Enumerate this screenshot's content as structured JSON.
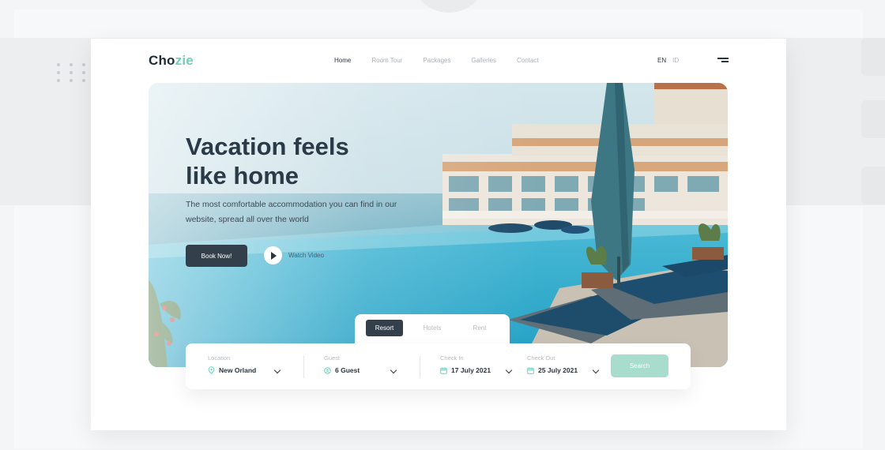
{
  "brand": {
    "logo_prefix": "Cho",
    "logo_suffix": "zie"
  },
  "nav": {
    "items": [
      {
        "label": "Home",
        "active": true
      },
      {
        "label": "Room Tour",
        "active": false
      },
      {
        "label": "Packages",
        "active": false
      },
      {
        "label": "Galleries",
        "active": false
      },
      {
        "label": "Contact",
        "active": false
      }
    ]
  },
  "language": {
    "current": "EN",
    "other": "ID"
  },
  "hero": {
    "headline_line1": "Vacation feels",
    "headline_line2": "like home",
    "subheadline": "The most comfortable accommodation you can find in our website, spread all over the world",
    "book_label": "Book Now!",
    "watch_label": "Watch Video"
  },
  "booking": {
    "tabs": [
      {
        "label": "Resort",
        "active": true
      },
      {
        "label": "Hotels",
        "active": false
      },
      {
        "label": "Rent",
        "active": false
      }
    ],
    "location": {
      "label": "Location",
      "value": "New Orland"
    },
    "guest": {
      "label": "Guest",
      "value": "6 Guest"
    },
    "check_in": {
      "label": "Check In",
      "value": "17 July 2021"
    },
    "check_out": {
      "label": "Check Out",
      "value": "25 July 2021"
    },
    "search_label": "Search"
  },
  "colors": {
    "accent": "#6fcfb7",
    "dark": "#33404b",
    "search_button": "#a8dccd"
  },
  "icons": [
    "menu-icon",
    "play-icon",
    "location-pin-icon",
    "guest-icon",
    "calendar-icon",
    "chevron-down-icon"
  ]
}
